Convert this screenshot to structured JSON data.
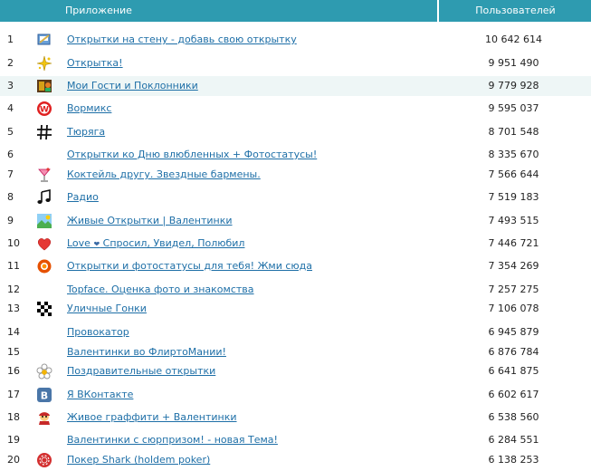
{
  "header": {
    "app": "Приложение",
    "users": "Пользователей"
  },
  "rows": [
    {
      "rank": "1",
      "name": "Открытки на стену - добавь свою открытку",
      "users": "10 642 614",
      "icon": "postcard-icon"
    },
    {
      "rank": "2",
      "name": "Открытка!",
      "users": "9 951 490",
      "icon": "sparkle-icon"
    },
    {
      "rank": "3",
      "name": "Мои Гости и Поклонники",
      "users": "9 779 928",
      "icon": "guests-icon"
    },
    {
      "rank": "4",
      "name": "Вормикс",
      "users": "9 595 037",
      "icon": "wormix-icon"
    },
    {
      "rank": "5",
      "name": "Тюряга",
      "users": "8 701 548",
      "icon": "hash-icon"
    },
    {
      "rank": "6",
      "name": "Открытки ко Дню влюбленных + Фотостатусы!",
      "users": "8 335 670",
      "icon": ""
    },
    {
      "rank": "7",
      "name": "Коктейль другу. Звездные бармены.",
      "users": "7 566 644",
      "icon": "cocktail-icon"
    },
    {
      "rank": "8",
      "name": "Радио",
      "users": "7 519 183",
      "icon": "music-note-icon"
    },
    {
      "rank": "9",
      "name": "Живые Открытки | Валентинки",
      "users": "7 493 515",
      "icon": "landscape-icon"
    },
    {
      "rank": "10",
      "name": "Love ❤ Спросил, Увидел, Полюбил",
      "users": "7 446 721",
      "icon": "heart-icon"
    },
    {
      "rank": "11",
      "name": "Открытки и фотостатусы для тебя! Жми сюда",
      "users": "7 354 269",
      "icon": "orange-ring-icon"
    },
    {
      "rank": "12",
      "name": "Topface. Оценка фото и знакомства",
      "users": "7 257 275",
      "icon": ""
    },
    {
      "rank": "13",
      "name": "Уличные Гонки",
      "users": "7 106 078",
      "icon": "checkered-flag-icon"
    },
    {
      "rank": "14",
      "name": "Провокатор",
      "users": "6 945 879",
      "icon": ""
    },
    {
      "rank": "15",
      "name": "Валентинки во ФлиртоМании!",
      "users": "6 876 784",
      "icon": ""
    },
    {
      "rank": "16",
      "name": "Поздравительные открытки",
      "users": "6 641 875",
      "icon": "flower-icon"
    },
    {
      "rank": "17",
      "name": "Я ВКонтакте",
      "users": "6 602 617",
      "icon": "vk-icon"
    },
    {
      "rank": "18",
      "name": "Живое граффити + Валентинки",
      "users": "6 538 560",
      "icon": "graffiti-icon"
    },
    {
      "rank": "19",
      "name": "Валентинки с сюрпризом! - новая Тема!",
      "users": "6 284 551",
      "icon": ""
    },
    {
      "rank": "20",
      "name": "Покер Shark (holdem poker)",
      "users": "6 138 253",
      "icon": "poker-chip-icon"
    }
  ]
}
